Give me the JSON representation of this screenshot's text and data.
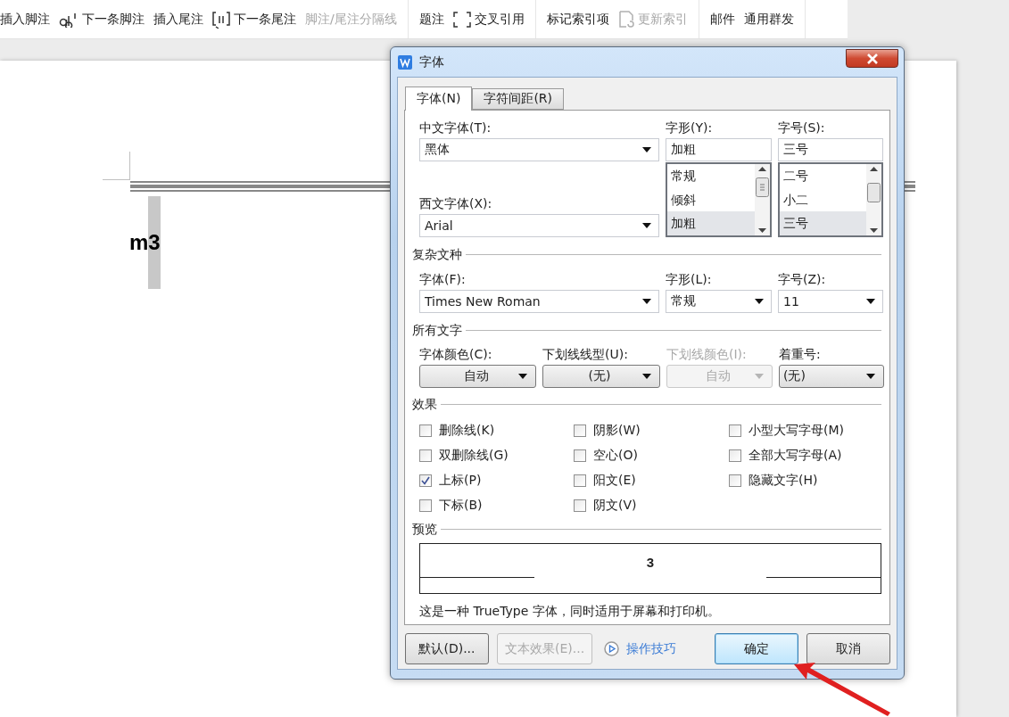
{
  "toolbar": {
    "groups": [
      {
        "items": [
          {
            "label": "插入脚注",
            "kind": "text",
            "disabled": false
          },
          {
            "label": "下一条脚注",
            "kind": "icon",
            "disabled": false
          },
          {
            "label": "插入尾注",
            "kind": "text",
            "disabled": false
          },
          {
            "label": "下一条尾注",
            "kind": "icon",
            "disabled": false
          },
          {
            "label": "脚注/尾注分隔线",
            "kind": "text",
            "disabled": true
          }
        ]
      },
      {
        "items": [
          {
            "label": "题注",
            "kind": "text",
            "disabled": false
          },
          {
            "label": "交叉引用",
            "kind": "icon",
            "disabled": false
          }
        ]
      },
      {
        "items": [
          {
            "label": "标记索引项",
            "kind": "text",
            "disabled": false
          },
          {
            "label": "更新索引",
            "kind": "icon",
            "disabled": true
          }
        ]
      },
      {
        "items": [
          {
            "label": "邮件",
            "kind": "text",
            "disabled": false
          },
          {
            "label": "通用群发",
            "kind": "text",
            "disabled": false
          }
        ]
      }
    ]
  },
  "document": {
    "runs": [
      {
        "text": "m",
        "selected": false
      },
      {
        "text": "3",
        "selected": true
      }
    ]
  },
  "dialog": {
    "title": "字体",
    "tabs": [
      {
        "label": "字体(N)",
        "selected": true
      },
      {
        "label": "字符间距(R)",
        "selected": false
      }
    ],
    "chinese_font": {
      "label": "中文字体(T):",
      "value": "黑体"
    },
    "western_font": {
      "label": "西文字体(X):",
      "value": "Arial"
    },
    "style": {
      "label": "字形(Y):",
      "value": "加粗",
      "options": [
        {
          "label": "常规",
          "selected": false
        },
        {
          "label": "倾斜",
          "selected": false
        },
        {
          "label": "加粗",
          "selected": true
        }
      ]
    },
    "size": {
      "label": "字号(S):",
      "value": "三号",
      "options": [
        {
          "label": "二号",
          "selected": false
        },
        {
          "label": "小二",
          "selected": false
        },
        {
          "label": "三号",
          "selected": true
        }
      ]
    },
    "complex": {
      "heading": "复杂文种",
      "fields": [
        {
          "label": "字体(F):",
          "value": "Times New Roman"
        },
        {
          "label": "字形(L):",
          "value": "常规"
        },
        {
          "label": "字号(Z):",
          "value": "11"
        }
      ]
    },
    "all_text": {
      "heading": "所有文字",
      "fields": [
        {
          "label": "字体颜色(C):",
          "value": "自动",
          "kind": "button",
          "disabled": false
        },
        {
          "label": "下划线线型(U):",
          "value": "(无)",
          "kind": "button",
          "disabled": false
        },
        {
          "label": "下划线颜色(I):",
          "value": "自动",
          "kind": "button",
          "disabled": true
        },
        {
          "label": "着重号:",
          "value": "(无)",
          "kind": "combo",
          "disabled": false
        }
      ]
    },
    "effects": {
      "heading": "效果",
      "options": [
        {
          "label": "删除线(K)",
          "checked": false
        },
        {
          "label": "阴影(W)",
          "checked": false
        },
        {
          "label": "小型大写字母(M)",
          "checked": false
        },
        {
          "label": "双删除线(G)",
          "checked": false
        },
        {
          "label": "空心(O)",
          "checked": false
        },
        {
          "label": "全部大写字母(A)",
          "checked": false
        },
        {
          "label": "上标(P)",
          "checked": true
        },
        {
          "label": "阳文(E)",
          "checked": false
        },
        {
          "label": "隐藏文字(H)",
          "checked": false
        },
        {
          "label": "下标(B)",
          "checked": false
        },
        {
          "label": "阴文(V)",
          "checked": false
        }
      ]
    },
    "preview": {
      "heading": "预览",
      "sample": "3",
      "note": "这是一种 TrueType 字体，同时适用于屏幕和打印机。"
    },
    "buttons": [
      {
        "label": "默认(D)...",
        "kind": "button",
        "disabled": false
      },
      {
        "label": "文本效果(E)...",
        "kind": "button",
        "disabled": true
      },
      {
        "label": "操作技巧",
        "kind": "link",
        "disabled": false
      },
      {
        "label": "确定",
        "kind": "default",
        "disabled": false
      },
      {
        "label": "取消",
        "kind": "button",
        "disabled": false
      }
    ]
  },
  "annotation": {
    "kind": "arrow"
  }
}
